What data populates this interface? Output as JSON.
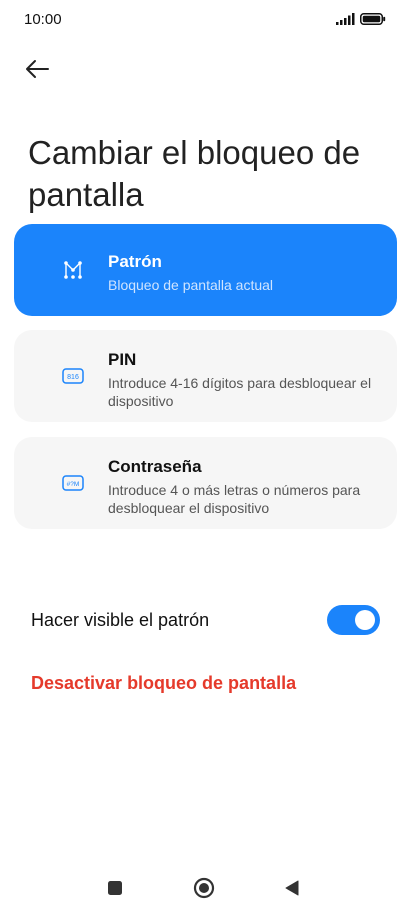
{
  "status_bar": {
    "time": "10:00"
  },
  "page": {
    "title": "Cambiar el bloqueo de pantalla"
  },
  "options": [
    {
      "label": "Patrón",
      "description": "Bloqueo de pantalla actual",
      "icon": "pattern-icon",
      "selected": true
    },
    {
      "label": "PIN",
      "description": "Introduce 4-16 dígitos para desbloquear el dispositivo",
      "icon": "pin-icon",
      "icon_text": "816",
      "selected": false
    },
    {
      "label": "Contraseña",
      "description": "Introduce 4 o más letras o números para desbloquear el dispositivo",
      "icon": "password-icon",
      "icon_text": "#?M",
      "selected": false
    }
  ],
  "visible_pattern": {
    "label": "Hacer visible el patrón",
    "enabled": true
  },
  "disable_lock": {
    "label": "Desactivar bloqueo de pantalla"
  },
  "colors": {
    "accent": "#1b84fb",
    "danger": "#e53a2b",
    "card_bg": "#f6f6f6"
  },
  "nav": {
    "recents_icon": "square-icon",
    "home_icon": "circle-home-icon",
    "back_icon": "triangle-back-icon"
  }
}
